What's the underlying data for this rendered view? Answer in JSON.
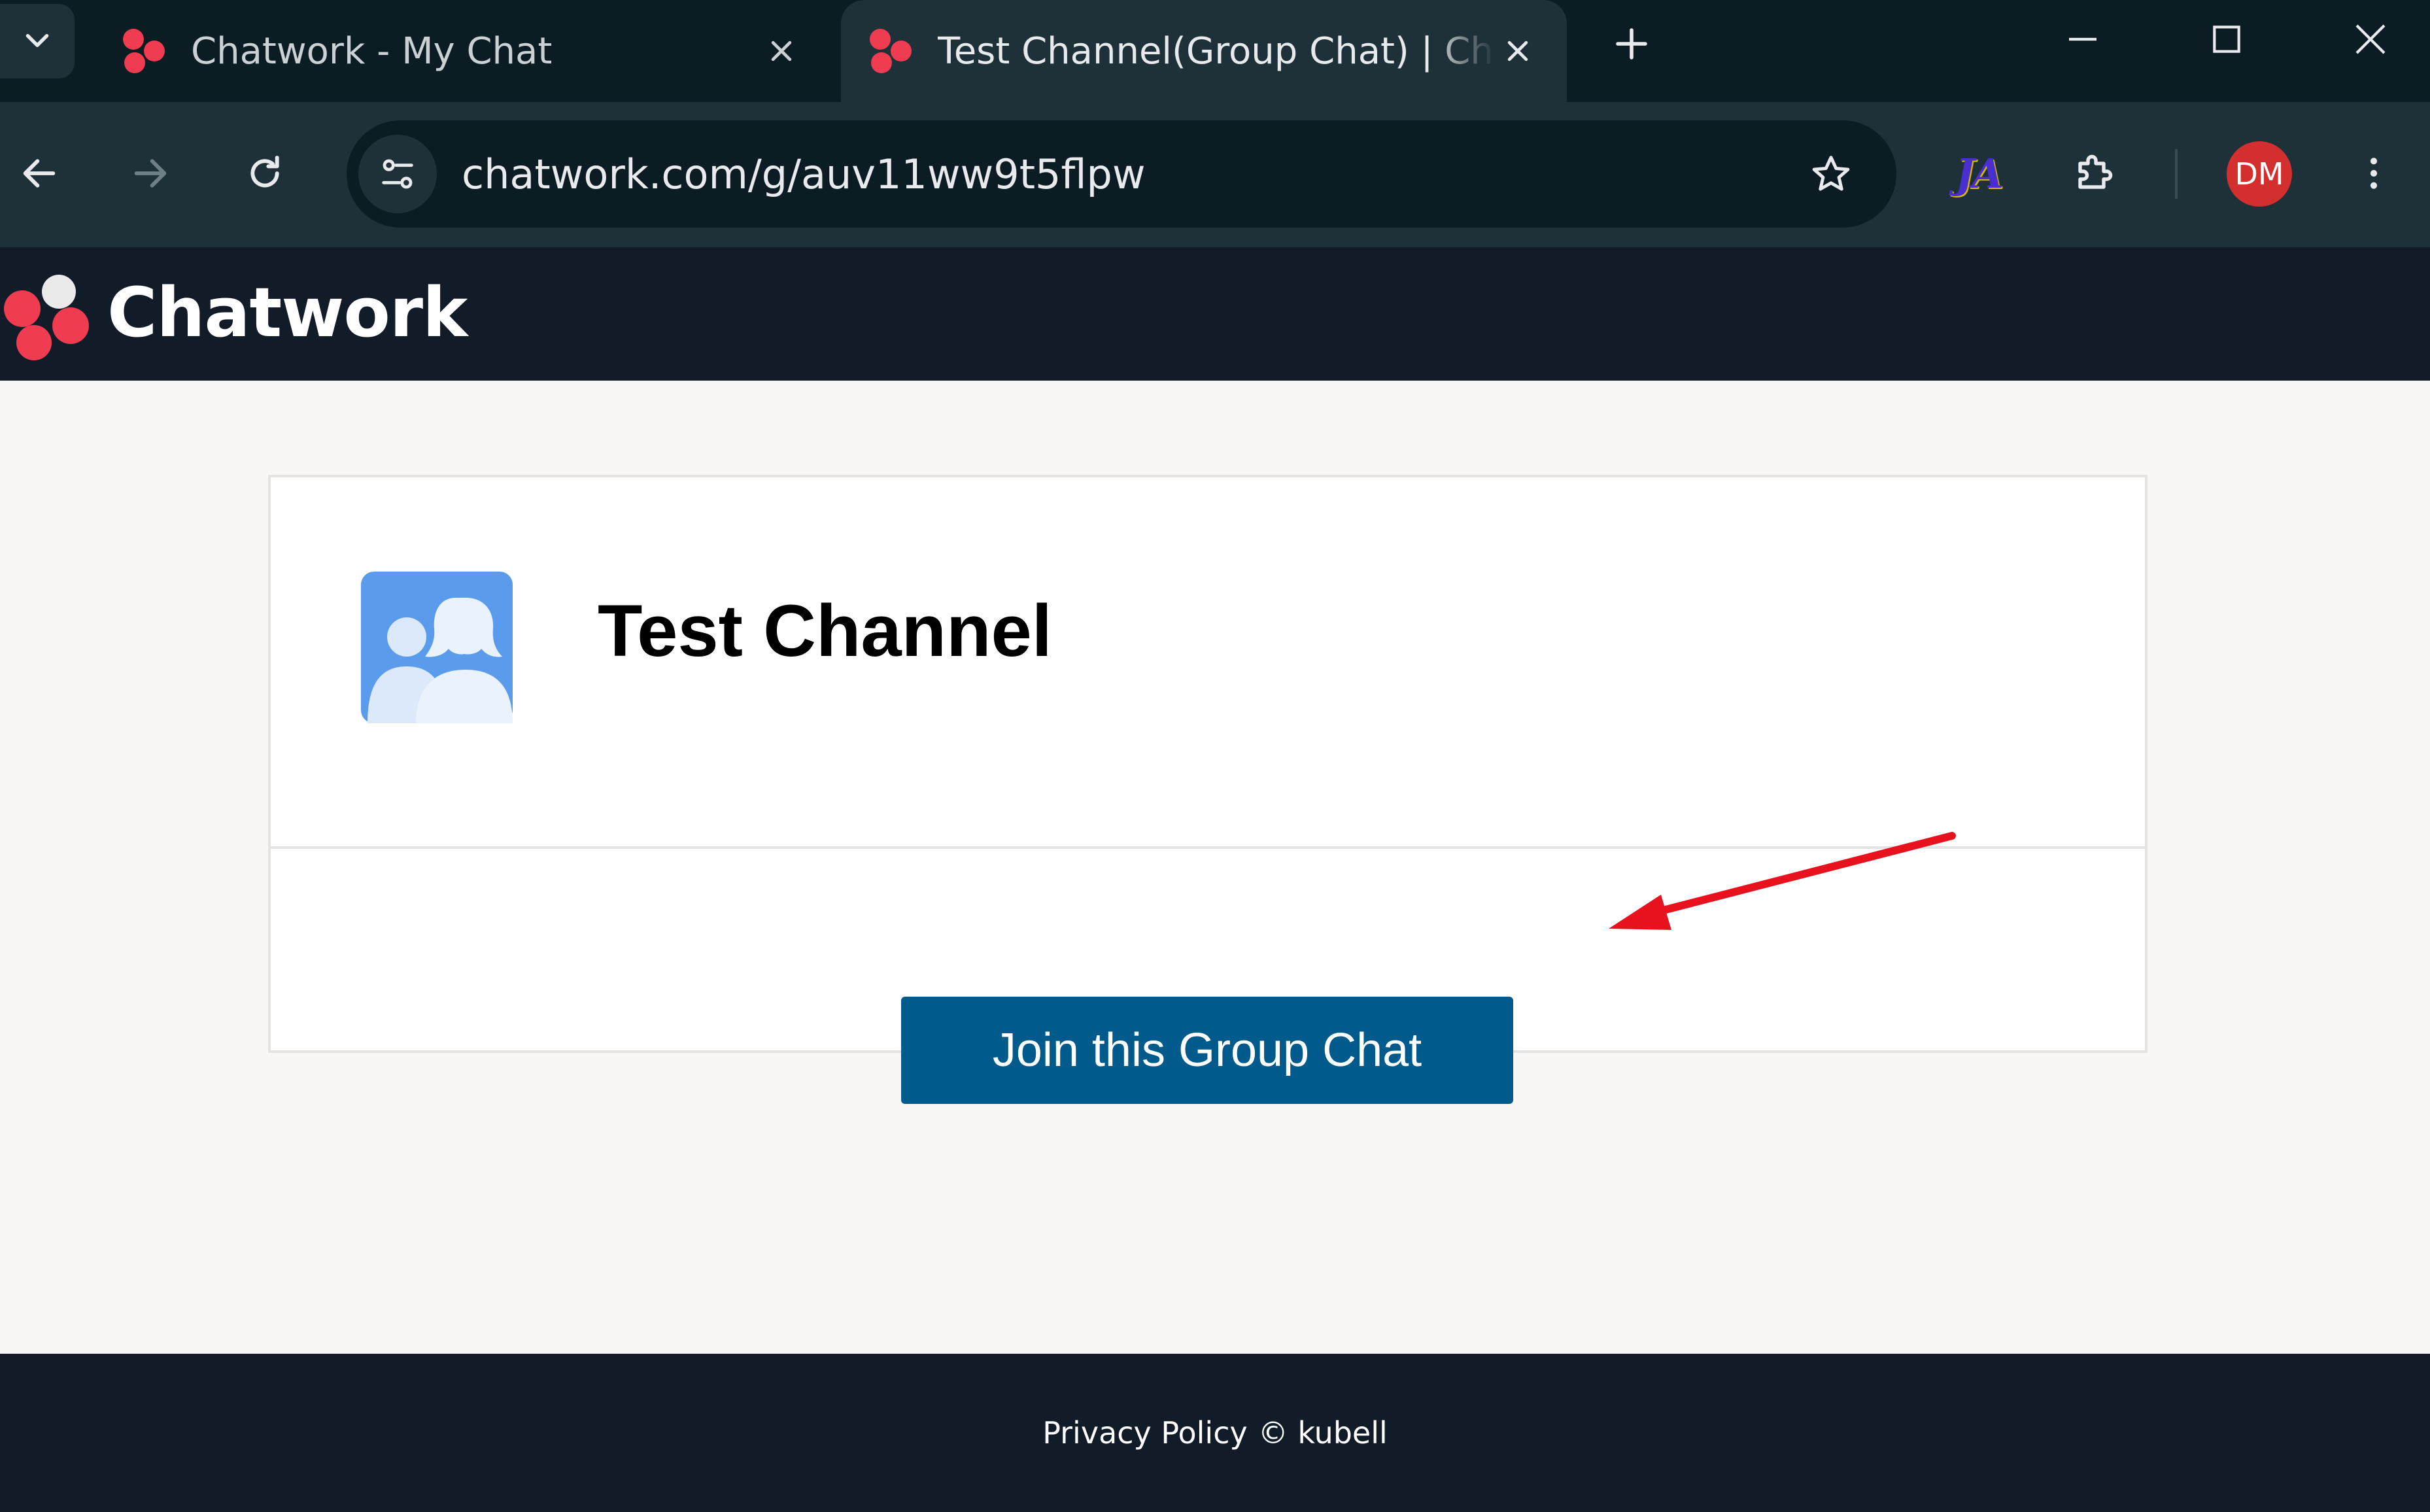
{
  "browser": {
    "tabs": [
      {
        "title": "Chatwork - My Chat",
        "active": false
      },
      {
        "title": "Test Channel(Group Chat) | Chatwork",
        "active": true
      }
    ],
    "address_bar": {
      "url": "chatwork.com/g/auv11ww9t5flpw"
    },
    "extension_label": "JA",
    "profile_initials": "DM",
    "icons": {
      "tab_search": "chevron-down-icon",
      "tab_close": "close-icon",
      "new_tab": "plus-icon",
      "back": "arrow-left-icon",
      "forward": "arrow-right-icon",
      "reload": "reload-icon",
      "site_info": "tune-icon",
      "bookmark": "star-icon",
      "extensions": "puzzle-icon",
      "menu": "more-vertical-icon",
      "minimize": "minimize-icon",
      "maximize": "maximize-icon",
      "close_window": "close-icon"
    }
  },
  "app": {
    "brand": "Chatwork",
    "group": {
      "name": "Test Channel",
      "icon": "group-people-icon"
    },
    "join_button_label": "Join this Group Chat",
    "footer": {
      "privacy_label": "Privacy Policy",
      "copyright": "© kubell"
    }
  },
  "colors": {
    "brand_red": "#f03c50",
    "header_bg": "#121b28",
    "join_button_bg": "#005a8b",
    "annotation_arrow": "#e8121e",
    "browser_frame": "#0b1c22",
    "browser_toolbar": "#1f3138"
  }
}
